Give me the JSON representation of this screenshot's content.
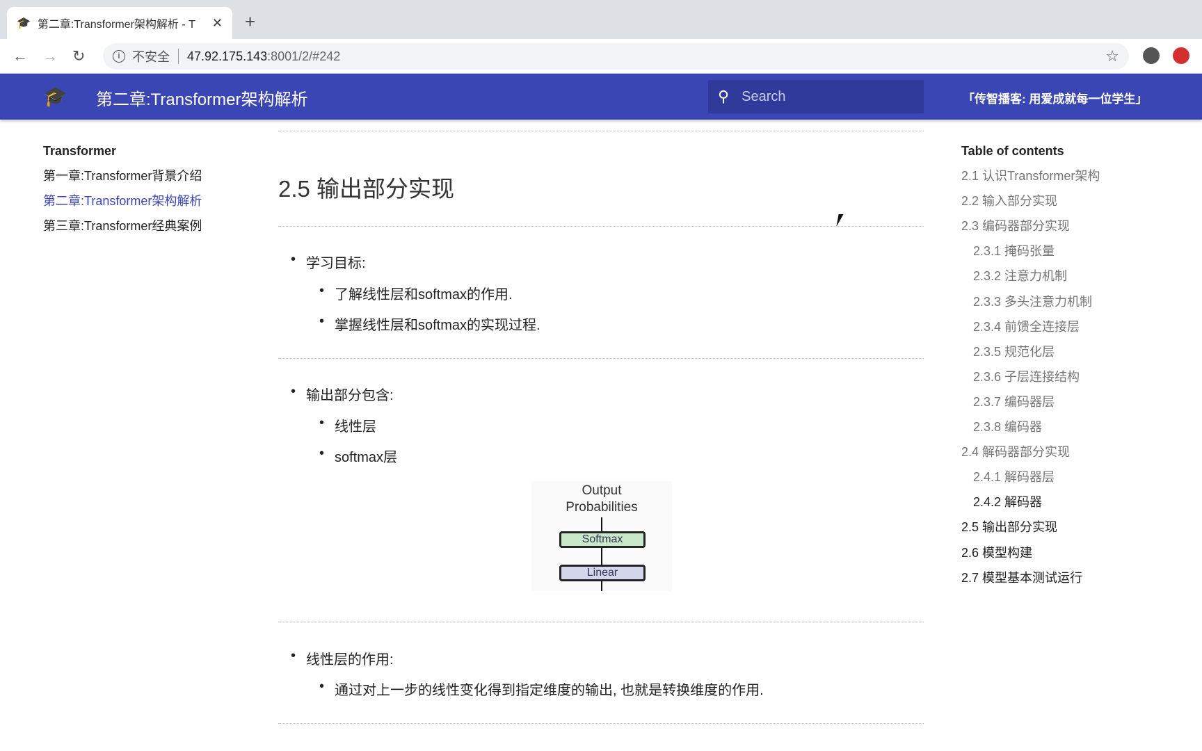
{
  "browser": {
    "tab_title": "第二章:Transformer架构解析 - T",
    "url_host": "47.92.175.143",
    "url_rest": ":8001/2/#242",
    "security": "不安全"
  },
  "header": {
    "title": "第二章:Transformer架构解析",
    "search_placeholder": "Search",
    "slogan": "「传智播客: 用爱成就每一位学生」",
    "color": "#3a46b4"
  },
  "sidebar": {
    "title": "Transformer",
    "items": [
      {
        "label": "第一章:Transformer背景介绍"
      },
      {
        "label": "第二章:Transformer架构解析",
        "active": true
      },
      {
        "label": "第三章:Transformer经典案例"
      }
    ]
  },
  "main": {
    "heading": "2.5 输出部分实现",
    "sections": [
      {
        "label": "学习目标:",
        "items": [
          "了解线性层和softmax的作用.",
          "掌握线性层和softmax的实现过程."
        ]
      },
      {
        "label": "输出部分包含:",
        "items": [
          "线性层",
          "softmax层"
        ]
      },
      {
        "label": "线性层的作用:",
        "items": [
          "通过对上一步的线性变化得到指定维度的输出, 也就是转换维度的作用."
        ]
      }
    ],
    "diagram": {
      "top": "Output",
      "top2": "Probabilities",
      "softmax": "Softmax",
      "linear": "Linear"
    }
  },
  "toc": {
    "title": "Table of contents",
    "items": [
      "2.1 认识Transformer架构",
      "2.2 输入部分实现",
      "2.3 编码器部分实现",
      "2.3.1 掩码张量",
      "2.3.2 注意力机制",
      "2.3.3 多头注意力机制",
      "2.3.4 前馈全连接层",
      "2.3.5 规范化层",
      "2.3.6 子层连接结构",
      "2.3.7 编码器层",
      "2.3.8 编码器",
      "2.4 解码器部分实现",
      "2.4.1 解码器层",
      "2.4.2 解码器",
      "2.5 输出部分实现",
      "2.6 模型构建",
      "2.7 模型基本测试运行"
    ]
  }
}
